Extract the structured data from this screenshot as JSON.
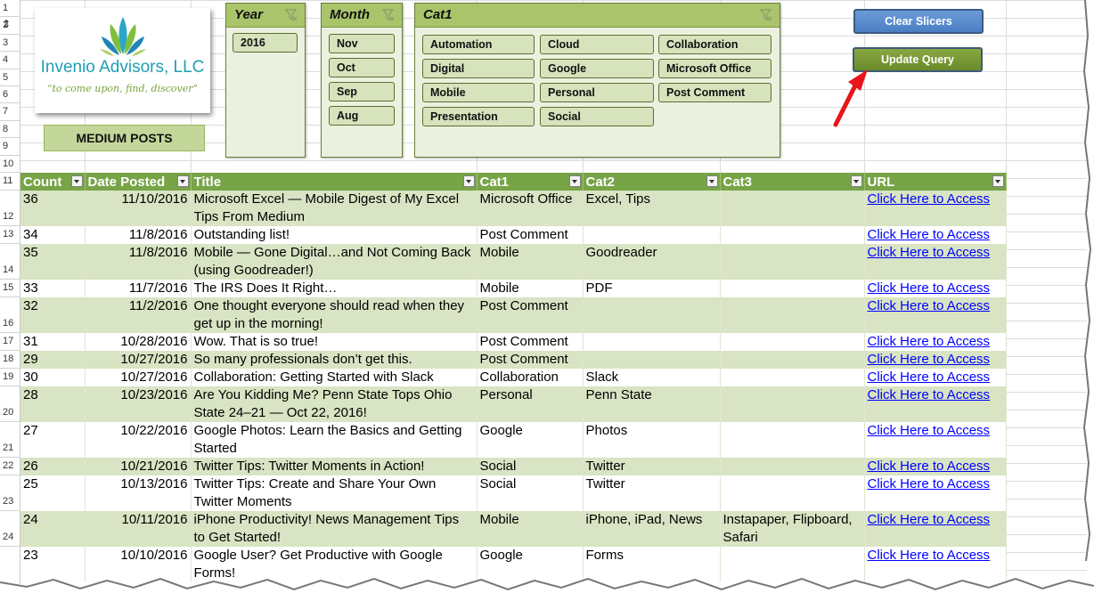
{
  "row_numbers": [
    "1",
    "2",
    "3",
    "4",
    "5",
    "6",
    "7",
    "8",
    "9",
    "10",
    "11",
    "12",
    "13",
    "14",
    "15",
    "16",
    "17",
    "18",
    "19",
    "20",
    "21",
    "22",
    "23",
    "24"
  ],
  "logo": {
    "name": "Invenio Advisors, LLC",
    "tagline": "“to come upon, find, discover”"
  },
  "medium_posts_label": "MEDIUM POSTS",
  "slicers": {
    "year": {
      "title": "Year",
      "items": [
        "2016"
      ]
    },
    "month": {
      "title": "Month",
      "items": [
        "Nov",
        "Oct",
        "Sep",
        "Aug"
      ]
    },
    "cat1": {
      "title": "Cat1",
      "items": [
        "Automation",
        "Cloud",
        "Collaboration",
        "Digital",
        "Google",
        "Microsoft Office",
        "Mobile",
        "Personal",
        "Post Comment",
        "Presentation",
        "Social"
      ]
    }
  },
  "buttons": {
    "clear_slicers": "Clear Slicers",
    "update_query": "Update Query"
  },
  "colors": {
    "header_green": "#77a447",
    "band_green": "#d8e4c3",
    "slicer_header": "#a9c46a",
    "arrow_red": "#e8141b",
    "link_blue": "#0000ff"
  },
  "table": {
    "columns": [
      "Count",
      "Date Posted",
      "Title",
      "Cat1",
      "Cat2",
      "Cat3",
      "URL"
    ],
    "rows": [
      {
        "count": "36",
        "date": "11/10/2016",
        "title": "Microsoft Excel — Mobile Digest of My Excel Tips From Medium",
        "cat1": "Microsoft Office",
        "cat2": "Excel, Tips",
        "cat3": "",
        "url": "Click Here to Access"
      },
      {
        "count": "34",
        "date": "11/8/2016",
        "title": "Outstanding list!",
        "cat1": "Post Comment",
        "cat2": "",
        "cat3": "",
        "url": "Click Here to Access"
      },
      {
        "count": "35",
        "date": "11/8/2016",
        "title": "Mobile — Gone Digital…and Not Coming Back (using Goodreader!)",
        "cat1": "Mobile",
        "cat2": "Goodreader",
        "cat3": "",
        "url": "Click Here to Access"
      },
      {
        "count": "33",
        "date": "11/7/2016",
        "title": "The IRS Does It Right…",
        "cat1": "Mobile",
        "cat2": "PDF",
        "cat3": "",
        "url": "Click Here to Access"
      },
      {
        "count": "32",
        "date": "11/2/2016",
        "title": "One thought everyone should read when they get up in the morning!",
        "cat1": "Post Comment",
        "cat2": "",
        "cat3": "",
        "url": "Click Here to Access"
      },
      {
        "count": "31",
        "date": "10/28/2016",
        "title": "Wow. That is so true!",
        "cat1": "Post Comment",
        "cat2": "",
        "cat3": "",
        "url": "Click Here to Access"
      },
      {
        "count": "29",
        "date": "10/27/2016",
        "title": "So many professionals don’t get this.",
        "cat1": "Post Comment",
        "cat2": "",
        "cat3": "",
        "url": "Click Here to Access"
      },
      {
        "count": "30",
        "date": "10/27/2016",
        "title": "Collaboration: Getting Started with Slack",
        "cat1": "Collaboration",
        "cat2": "Slack",
        "cat3": "",
        "url": "Click Here to Access"
      },
      {
        "count": "28",
        "date": "10/23/2016",
        "title": "Are You Kidding Me? Penn State Tops Ohio State 24–21 — Oct 22, 2016!",
        "cat1": "Personal",
        "cat2": "Penn State",
        "cat3": "",
        "url": "Click Here to Access"
      },
      {
        "count": "27",
        "date": "10/22/2016",
        "title": "Google Photos: Learn the Basics and Getting Started",
        "cat1": "Google",
        "cat2": "Photos",
        "cat3": "",
        "url": "Click Here to Access"
      },
      {
        "count": "26",
        "date": "10/21/2016",
        "title": "Twitter Tips: Twitter Moments in Action!",
        "cat1": "Social",
        "cat2": "Twitter",
        "cat3": "",
        "url": "Click Here to Access"
      },
      {
        "count": "25",
        "date": "10/13/2016",
        "title": "Twitter Tips: Create and Share Your Own Twitter Moments",
        "cat1": "Social",
        "cat2": "Twitter",
        "cat3": "",
        "url": "Click Here to Access"
      },
      {
        "count": "24",
        "date": "10/11/2016",
        "title": "iPhone Productivity! News Management Tips to Get Started!",
        "cat1": "Mobile",
        "cat2": "iPhone, iPad, News",
        "cat3": "Instapaper, Flipboard, Safari",
        "url": "Click Here to Access"
      },
      {
        "count": "23",
        "date": "10/10/2016",
        "title": "Google User? Get Productive with Google Forms!",
        "cat1": "Google",
        "cat2": "Forms",
        "cat3": "",
        "url": "Click Here to Access"
      }
    ]
  }
}
